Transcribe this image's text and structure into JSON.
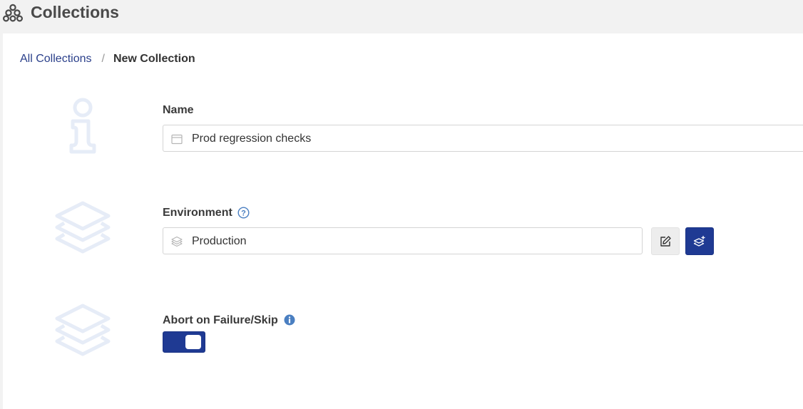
{
  "header": {
    "title": "Collections",
    "icon": "collections-icon"
  },
  "breadcrumb": {
    "parent": "All Collections",
    "separator": "/",
    "current": "New Collection"
  },
  "form": {
    "name": {
      "label": "Name",
      "value": "Prod regression checks",
      "icon": "calendar-icon"
    },
    "environment": {
      "label": "Environment",
      "value": "Production",
      "icon": "layers-icon",
      "help_icon": "question-circle-icon",
      "edit_icon": "edit-icon",
      "add_icon": "add-environment-icon"
    },
    "abort_on_failure": {
      "label": "Abort on Failure/Skip",
      "info_icon": "info-circle-icon",
      "enabled": true
    }
  },
  "colors": {
    "accent": "#1f3a93",
    "link": "#2a3f8a",
    "decor_icon": "#e6ecf7",
    "help": "#4a7fc1"
  }
}
